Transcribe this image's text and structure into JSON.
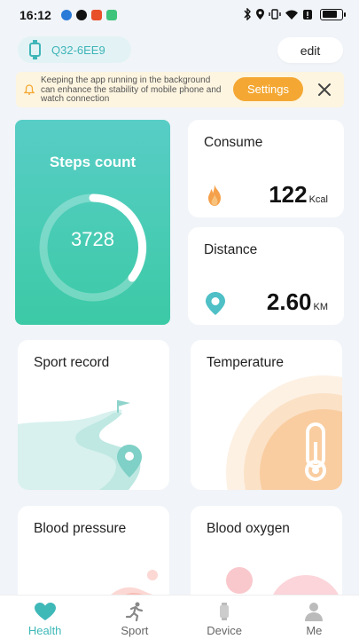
{
  "status_bar": {
    "time": "16:12"
  },
  "header": {
    "device_name": "Q32-6EE9",
    "edit_label": "edit"
  },
  "notice": {
    "message": "Keeping the app running in the background can enhance the stability of mobile phone and watch connection",
    "settings_label": "Settings"
  },
  "steps": {
    "title": "Steps count",
    "value": "3728"
  },
  "consume": {
    "title": "Consume",
    "value": "122",
    "unit": "Kcal"
  },
  "distance": {
    "title": "Distance",
    "value": "2.60",
    "unit": "KM"
  },
  "cards": {
    "sport_record": "Sport record",
    "temperature": "Temperature",
    "blood_pressure": "Blood pressure",
    "blood_oxygen": "Blood oxygen"
  },
  "tabs": [
    {
      "label": "Health",
      "icon": "heart-icon",
      "active": true
    },
    {
      "label": "Sport",
      "icon": "runner-icon",
      "active": false
    },
    {
      "label": "Device",
      "icon": "watch-icon",
      "active": false
    },
    {
      "label": "Me",
      "icon": "person-icon",
      "active": false
    }
  ],
  "colors": {
    "accent": "#3fb8b8",
    "steps_card": "#4ccbb6",
    "settings_button": "#f4a833",
    "notice_bg": "#fdf5e0"
  }
}
